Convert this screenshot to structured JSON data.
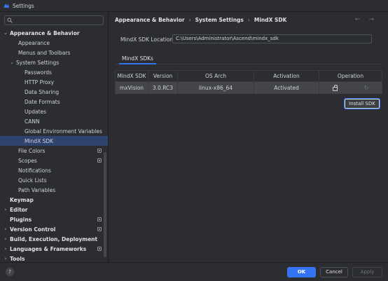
{
  "window": {
    "title": "Settings"
  },
  "search": {
    "placeholder": "",
    "value": ""
  },
  "sidebar": {
    "items": [
      {
        "label": "Appearance & Behavior",
        "level": 0,
        "chevron": "expanded",
        "bold": true
      },
      {
        "label": "Appearance",
        "level": 1
      },
      {
        "label": "Menus and Toolbars",
        "level": 1
      },
      {
        "label": "System Settings",
        "level": 1,
        "chevron": "expanded"
      },
      {
        "label": "Passwords",
        "level": 2
      },
      {
        "label": "HTTP Proxy",
        "level": 2
      },
      {
        "label": "Data Sharing",
        "level": 2
      },
      {
        "label": "Date Formats",
        "level": 2
      },
      {
        "label": "Updates",
        "level": 2
      },
      {
        "label": "CANN",
        "level": 2
      },
      {
        "label": "Global Environment Variables",
        "level": 2
      },
      {
        "label": "MindX SDK",
        "level": 2,
        "selected": true
      },
      {
        "label": "File Colors",
        "level": 1,
        "project_icon": true
      },
      {
        "label": "Scopes",
        "level": 1,
        "project_icon": true
      },
      {
        "label": "Notifications",
        "level": 1
      },
      {
        "label": "Quick Lists",
        "level": 1
      },
      {
        "label": "Path Variables",
        "level": 1
      },
      {
        "label": "Keymap",
        "level": 0,
        "bold": true
      },
      {
        "label": "Editor",
        "level": 0,
        "chevron": "collapsed",
        "bold": true
      },
      {
        "label": "Plugins",
        "level": 0,
        "bold": true,
        "project_icon": true
      },
      {
        "label": "Version Control",
        "level": 0,
        "chevron": "collapsed",
        "bold": true,
        "project_icon": true
      },
      {
        "label": "Build, Execution, Deployment",
        "level": 0,
        "chevron": "collapsed",
        "bold": true
      },
      {
        "label": "Languages & Frameworks",
        "level": 0,
        "chevron": "collapsed",
        "bold": true,
        "project_icon": true
      },
      {
        "label": "Tools",
        "level": 0,
        "chevron": "collapsed",
        "bold": true
      }
    ]
  },
  "breadcrumb": [
    "Appearance & Behavior",
    "System Settings",
    "MindX SDK"
  ],
  "breadcrumb_separator": "›",
  "nav": {
    "back": "←",
    "forward": "→"
  },
  "location": {
    "label": "MindX SDK Location",
    "value": "C:\\Users\\Administrator\\Ascend\\mindx_sdk"
  },
  "tabs": [
    {
      "label": "MindX SDKs",
      "active": true
    }
  ],
  "table": {
    "headers": [
      "MindX SDK",
      "Version",
      "OS Arch",
      "Activation",
      "Operation"
    ],
    "rows": [
      {
        "sdk": "mxVision",
        "version": "3.0.RC3",
        "arch": "linux-x86_64",
        "activation": "Activated"
      }
    ]
  },
  "install_button": "Install SDK",
  "footer": {
    "help": "?",
    "ok": "OK",
    "cancel": "Cancel",
    "apply": "Apply"
  },
  "colors": {
    "accent": "#3574f0",
    "selection": "#2e436e",
    "background": "#2b2d30"
  }
}
